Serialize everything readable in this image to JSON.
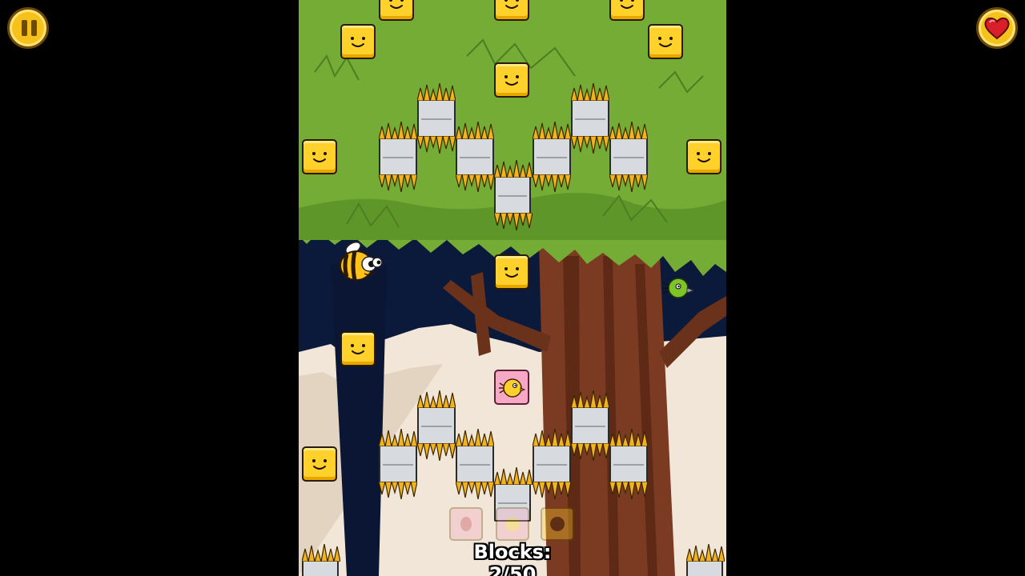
{
  "hud": {
    "pause_icon": "pause-icon",
    "life_icon": "heart-icon",
    "blocks_counter": "Blocks: 2/50"
  },
  "colors": {
    "sky_green": "#74ac35",
    "block_yellow": "#ffd12a",
    "spike_gold": "#f2b41a",
    "pink_block": "#f7a8c4",
    "hud_gold": "#f4c21a"
  },
  "characters": {
    "player": "bee",
    "enemy": "green-bird"
  },
  "inventory": [
    "bug-token",
    "bird-token",
    "bee-token"
  ]
}
